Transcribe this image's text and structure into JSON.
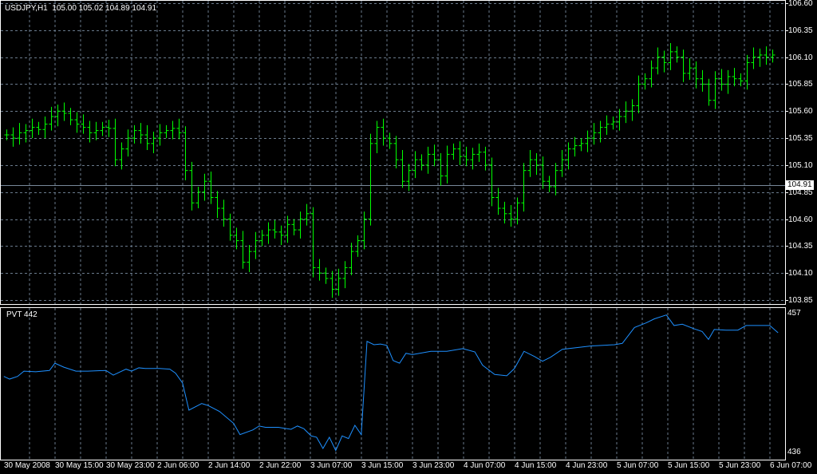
{
  "header": {
    "symbol": "USDJPY,H1",
    "open": "105.00",
    "high": "105.02",
    "low": "104.89",
    "close": "104.91"
  },
  "bid_label": "104.91",
  "price_axis": [
    "106.60",
    "106.35",
    "106.10",
    "105.85",
    "105.60",
    "105.35",
    "105.10",
    "104.85",
    "104.60",
    "104.35",
    "104.10",
    "103.85"
  ],
  "indicator": {
    "title": "PVT 442",
    "axis_max": "457",
    "axis_min": "436"
  },
  "time_axis": [
    "30 May 2008",
    "30 May 15:00",
    "30 May 23:00",
    "2 Jun 06:00",
    "2 Jun 14:00",
    "2 Jun 22:00",
    "3 Jun 07:00",
    "3 Jun 15:00",
    "3 Jun 23:00",
    "4 Jun 07:00",
    "4 Jun 15:00",
    "4 Jun 23:00",
    "5 Jun 07:00",
    "5 Jun 15:00",
    "5 Jun 23:00",
    "6 Jun 07:00"
  ],
  "colors": {
    "bull": "#00ff00",
    "bear": "#00ff00",
    "grid": "#6a7a8c",
    "pvt": "#1e90ff",
    "bid_line": "#778899"
  },
  "chart_data": {
    "type": "ohlc",
    "closes": [
      105.38,
      105.35,
      105.4,
      105.42,
      105.45,
      105.43,
      105.48,
      105.55,
      105.6,
      105.58,
      105.52,
      105.48,
      105.45,
      105.4,
      105.42,
      105.45,
      105.44,
      105.15,
      105.25,
      105.35,
      105.42,
      105.38,
      105.3,
      105.35,
      105.4,
      105.42,
      105.44,
      105.4,
      105.05,
      104.75,
      104.85,
      104.95,
      104.8,
      104.7,
      104.6,
      104.45,
      104.4,
      104.2,
      104.3,
      104.4,
      104.45,
      104.5,
      104.48,
      104.45,
      104.55,
      104.5,
      104.6,
      104.65,
      104.15,
      104.1,
      104.05,
      103.95,
      104.05,
      104.15,
      104.3,
      104.4,
      104.6,
      105.3,
      105.45,
      105.35,
      105.3,
      105.15,
      104.95,
      105.05,
      105.15,
      105.1,
      105.2,
      105.15,
      105.0,
      105.2,
      105.25,
      105.18,
      105.15,
      105.2,
      105.22,
      105.1,
      104.8,
      104.7,
      104.65,
      104.6,
      104.75,
      105.05,
      105.15,
      105.1,
      104.95,
      104.9,
      105.05,
      105.15,
      105.25,
      105.28,
      105.3,
      105.35,
      105.4,
      105.45,
      105.48,
      105.5,
      105.55,
      105.6,
      105.65,
      105.85,
      105.9,
      106.0,
      106.1,
      106.05,
      106.15,
      106.1,
      105.95,
      106.0,
      105.9,
      105.85,
      105.7,
      105.9,
      105.85,
      105.92,
      105.9,
      105.88,
      106.05,
      106.1,
      106.12,
      106.1,
      106.12
    ],
    "price_range": [
      103.85,
      106.6
    ],
    "pvt": [
      [
        -0.4,
        447.5
      ],
      [
        0.5,
        447.1
      ],
      [
        1.75,
        447.5
      ],
      [
        2.75,
        448.3
      ],
      [
        4.6,
        448.2
      ],
      [
        6.75,
        448.4
      ],
      [
        7.6,
        449.5
      ],
      [
        9,
        448.9
      ],
      [
        10.9,
        448.3
      ],
      [
        12.75,
        448.3
      ],
      [
        15.6,
        448.4
      ],
      [
        16.75,
        447.7
      ],
      [
        18.75,
        448.6
      ],
      [
        19.6,
        448.3
      ],
      [
        20.75,
        448.8
      ],
      [
        21.75,
        448.7
      ],
      [
        24,
        448.7
      ],
      [
        25.6,
        448.6
      ],
      [
        26.5,
        448.0
      ],
      [
        27.6,
        446.5
      ],
      [
        28.6,
        442.4
      ],
      [
        30.6,
        443.4
      ],
      [
        31.6,
        443.1
      ],
      [
        33.4,
        442.2
      ],
      [
        35.6,
        440.4
      ],
      [
        36.6,
        438.7
      ],
      [
        38.6,
        439.4
      ],
      [
        39.6,
        440.0
      ],
      [
        40.6,
        439.8
      ],
      [
        42.6,
        439.8
      ],
      [
        44.6,
        439.5
      ],
      [
        45.6,
        440.0
      ],
      [
        46.6,
        439.6
      ],
      [
        47.75,
        438.5
      ],
      [
        48.6,
        438.3
      ],
      [
        49.6,
        436.6
      ],
      [
        50.6,
        438.3
      ],
      [
        51.6,
        436.3
      ],
      [
        52.6,
        438.5
      ],
      [
        53.6,
        438.1
      ],
      [
        54.6,
        440.1
      ],
      [
        55.6,
        438.7
      ],
      [
        56.5,
        452.8
      ],
      [
        57.6,
        452.3
      ],
      [
        58.6,
        452.4
      ],
      [
        59.6,
        452.2
      ],
      [
        60.6,
        449.9
      ],
      [
        61.6,
        449.5
      ],
      [
        62.6,
        451.0
      ],
      [
        63.6,
        450.8
      ],
      [
        66.5,
        451.3
      ],
      [
        69,
        451.3
      ],
      [
        71.5,
        451.7
      ],
      [
        73.4,
        451.2
      ],
      [
        74.6,
        449.2
      ],
      [
        76.5,
        447.8
      ],
      [
        78.4,
        447.6
      ],
      [
        79.6,
        448.7
      ],
      [
        81.1,
        451.3
      ],
      [
        82.75,
        450.5
      ],
      [
        84,
        449.8
      ],
      [
        85.25,
        450.4
      ],
      [
        87.1,
        451.6
      ],
      [
        91.5,
        452.1
      ],
      [
        95.25,
        452.3
      ],
      [
        96.5,
        452.5
      ],
      [
        98.4,
        454.9
      ],
      [
        100.25,
        455.6
      ],
      [
        101.5,
        456.2
      ],
      [
        103.4,
        456.8
      ],
      [
        104.6,
        455.2
      ],
      [
        105.9,
        455.4
      ],
      [
        107.75,
        454.7
      ],
      [
        109,
        454.3
      ],
      [
        110,
        453.1
      ],
      [
        110.9,
        454.6
      ],
      [
        112.75,
        454.5
      ],
      [
        114.6,
        454.5
      ],
      [
        115.9,
        455.2
      ],
      [
        117.75,
        455.2
      ],
      [
        119.6,
        455.2
      ],
      [
        120.9,
        454.1
      ]
    ],
    "pvt_range": [
      436,
      457
    ]
  }
}
